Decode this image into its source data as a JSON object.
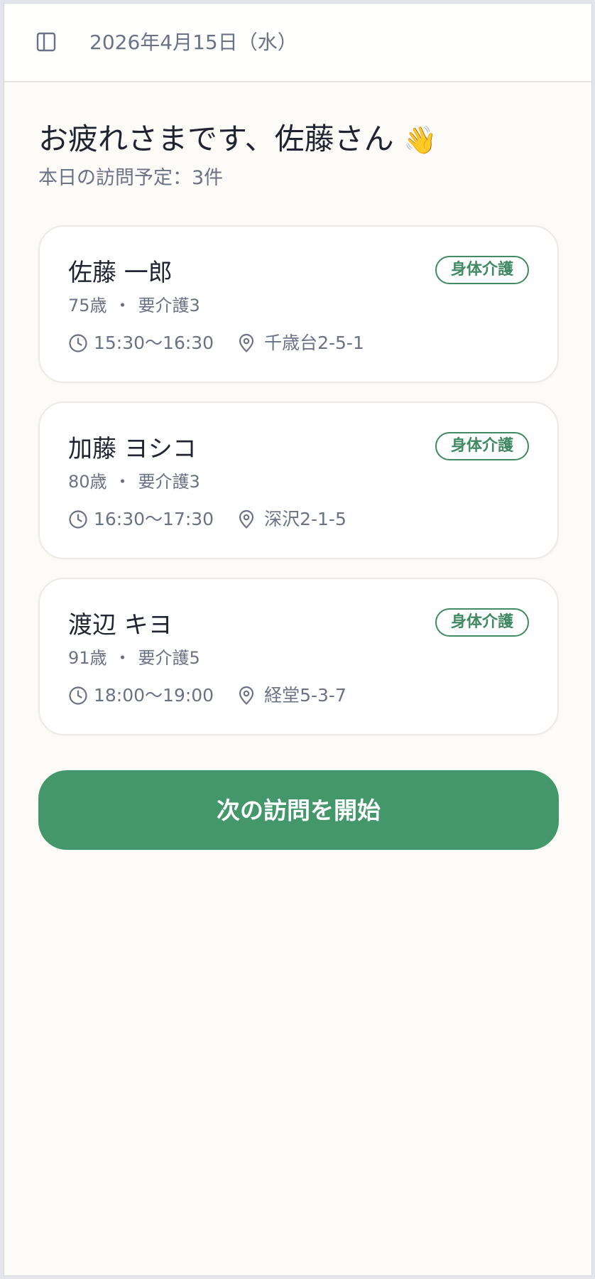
{
  "header": {
    "date": "2026年4月15日（水）",
    "sidebar_icon": "sidebar-panel-icon"
  },
  "greeting": {
    "title": "お疲れさまです、佐藤さん",
    "emoji": "👋",
    "subtitle": "本日の訪問予定：3件"
  },
  "visits": [
    {
      "name": "佐藤 一郎",
      "age": "75歳",
      "care_level": "要介護3",
      "separator": "・",
      "badge": "身体介護",
      "time": "15:30〜16:30",
      "address": "千歳台2-5-1"
    },
    {
      "name": "加藤 ヨシコ",
      "age": "80歳",
      "care_level": "要介護3",
      "separator": "・",
      "badge": "身体介護",
      "time": "16:30〜17:30",
      "address": "深沢2-1-5"
    },
    {
      "name": "渡辺 キヨ",
      "age": "91歳",
      "care_level": "要介護5",
      "separator": "・",
      "badge": "身体介護",
      "time": "18:00〜19:00",
      "address": "経堂5-3-7"
    }
  ],
  "actions": {
    "start_label": "次の訪問を開始"
  },
  "colors": {
    "accent": "#43976a",
    "badge": "#3f8a62",
    "muted_text": "#6b7285",
    "background": "#fcfbf8"
  }
}
